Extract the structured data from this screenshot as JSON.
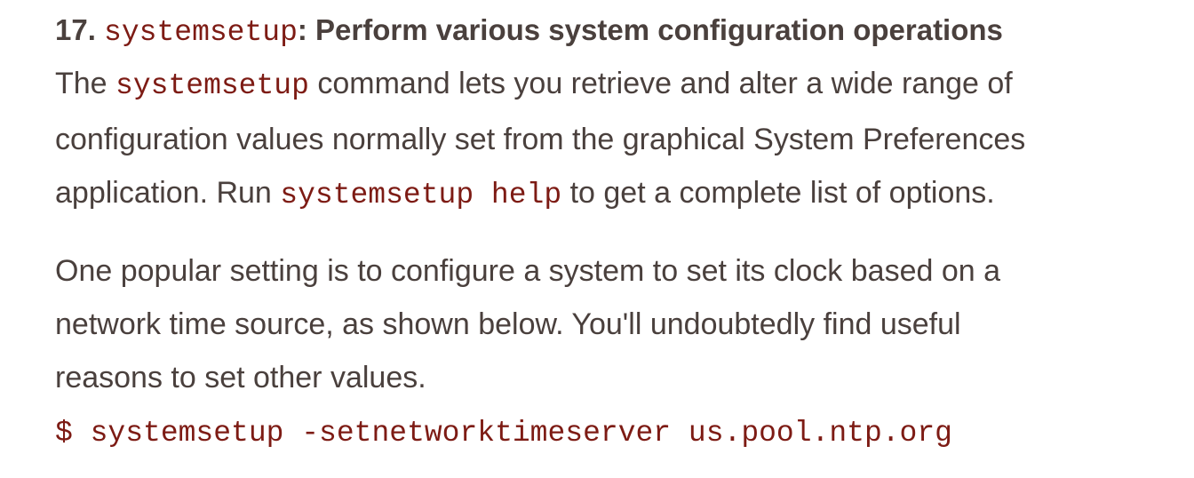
{
  "heading": {
    "number": "17. ",
    "command": "systemsetup",
    "title": ": Perform various system configuration operations"
  },
  "paragraph1": {
    "l1_a": "The ",
    "l1_code": "systemsetup",
    "l1_b": " command lets you retrieve and alter a wide range of",
    "l2": "configuration values normally set from the graphical System Preferences",
    "l3_a": "application. Run ",
    "l3_code": "systemsetup help",
    "l3_b": " to get a complete list of options."
  },
  "paragraph2": {
    "l1": "One popular setting is to configure a system to set its clock based on a",
    "l2": "network time source, as shown below. You'll undoubtedly find useful",
    "l3": "reasons to set other values."
  },
  "command_line": "$ systemsetup -setnetworktimeserver us.pool.ntp.org",
  "colors": {
    "text": "#4a403d",
    "code": "#7d1b14",
    "background": "#ffffff"
  }
}
